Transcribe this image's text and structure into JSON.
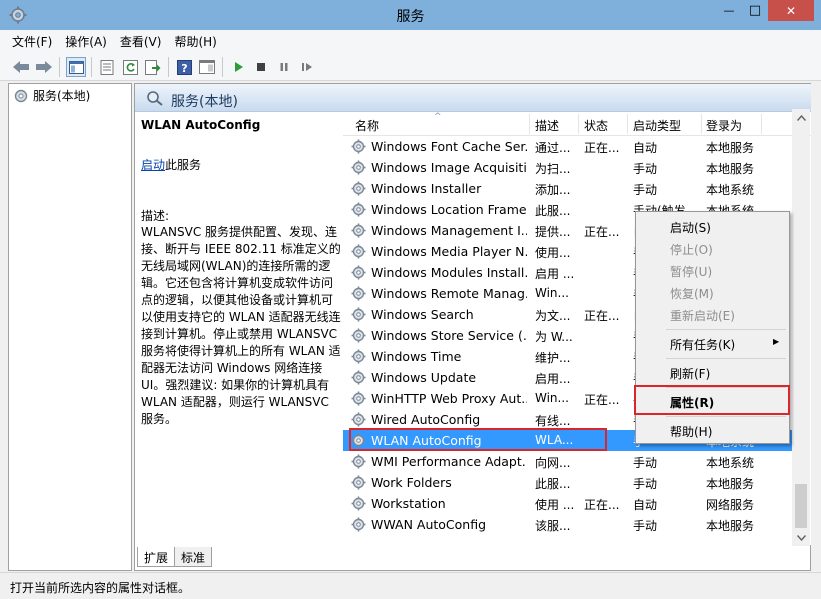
{
  "window": {
    "title": "服务",
    "minimize_glyph": "—",
    "maximize_glyph": "□",
    "close_glyph": "✕"
  },
  "menu": [
    "文件(F)",
    "操作(A)",
    "查看(V)",
    "帮助(H)"
  ],
  "tree": {
    "root_label": "服务(本地)"
  },
  "panel": {
    "header_title": "服务(本地)",
    "service_name": "WLAN AutoConfig",
    "start_link": "启动",
    "start_suffix": "此服务",
    "desc_label": "描述:",
    "desc_text": "WLANSVC 服务提供配置、发现、连接、断开与 IEEE 802.11 标准定义的无线局域网(WLAN)的连接所需的逻辑。它还包含将计算机变成软件访问点的逻辑，以便其他设备或计算机可以使用支持它的 WLAN 适配器无线连接到计算机。停止或禁用 WLANSVC 服务将使得计算机上的所有 WLAN 适配器无法访问 Windows 网络连接 UI。强烈建议: 如果你的计算机具有 WLAN 适配器，则运行 WLANSVC 服务。"
  },
  "columns": {
    "name": "名称",
    "desc": "描述",
    "status": "状态",
    "startup": "启动类型",
    "logon": "登录为",
    "sort_arrow": "^"
  },
  "rows": [
    {
      "name": "Windows Font Cache Ser...",
      "desc": "通过...",
      "status": "正在...",
      "startup": "自动",
      "logon": "本地服务"
    },
    {
      "name": "Windows Image Acquisiti...",
      "desc": "为扫...",
      "status": "",
      "startup": "手动",
      "logon": "本地服务"
    },
    {
      "name": "Windows Installer",
      "desc": "添加...",
      "status": "",
      "startup": "手动",
      "logon": "本地系统"
    },
    {
      "name": "Windows Location Frame...",
      "desc": "此服...",
      "status": "",
      "startup": "手动(触发...",
      "logon": "本地系统"
    },
    {
      "name": "Windows Management I...",
      "desc": "提供...",
      "status": "正在...",
      "startup": "自",
      "logon": ""
    },
    {
      "name": "Windows Media Player N...",
      "desc": "使用...",
      "status": "",
      "startup": "手",
      "logon": ""
    },
    {
      "name": "Windows Modules Install...",
      "desc": "启用 ...",
      "status": "",
      "startup": "手",
      "logon": ""
    },
    {
      "name": "Windows Remote Manag...",
      "desc": "Win...",
      "status": "",
      "startup": "手",
      "logon": ""
    },
    {
      "name": "Windows Search",
      "desc": "为文...",
      "status": "正在...",
      "startup": "自",
      "logon": ""
    },
    {
      "name": "Windows Store Service (...",
      "desc": "为 W...",
      "status": "",
      "startup": "手",
      "logon": ""
    },
    {
      "name": "Windows Time",
      "desc": "维护...",
      "status": "",
      "startup": "手",
      "logon": ""
    },
    {
      "name": "Windows Update",
      "desc": "启用...",
      "status": "",
      "startup": "手",
      "logon": ""
    },
    {
      "name": "WinHTTP Web Proxy Aut...",
      "desc": "Win...",
      "status": "正在...",
      "startup": "手",
      "logon": ""
    },
    {
      "name": "Wired AutoConfig",
      "desc": "有线...",
      "status": "",
      "startup": "手",
      "logon": ""
    },
    {
      "name": "WLAN AutoConfig",
      "desc": "WLA...",
      "status": "",
      "startup": "手",
      "logon": "本地系统"
    },
    {
      "name": "WMI Performance Adapt...",
      "desc": "向网...",
      "status": "",
      "startup": "手动",
      "logon": "本地系统"
    },
    {
      "name": "Work Folders",
      "desc": "此服...",
      "status": "",
      "startup": "手动",
      "logon": "本地服务"
    },
    {
      "name": "Workstation",
      "desc": "使用 ...",
      "status": "正在...",
      "startup": "自动",
      "logon": "网络服务"
    },
    {
      "name": "WWAN AutoConfig",
      "desc": "该服...",
      "status": "",
      "startup": "手动",
      "logon": "本地服务"
    }
  ],
  "selected_row": 14,
  "tabs": [
    "扩展",
    "标准"
  ],
  "status_text": "打开当前所选内容的属性对话框。",
  "context_menu": {
    "start": "启动(S)",
    "stop": "停止(O)",
    "pause": "暂停(U)",
    "resume": "恢复(M)",
    "restart": "重新启动(E)",
    "all_tasks": "所有任务(K)",
    "submenu_arrow": "▶",
    "refresh": "刷新(F)",
    "properties": "属性(R)",
    "help": "帮助(H)"
  },
  "colors": {
    "titlebar": "#7fb0dc",
    "close_button": "#c7504a",
    "selection": "#3399ff",
    "highlight_outline": "#d9262c"
  }
}
